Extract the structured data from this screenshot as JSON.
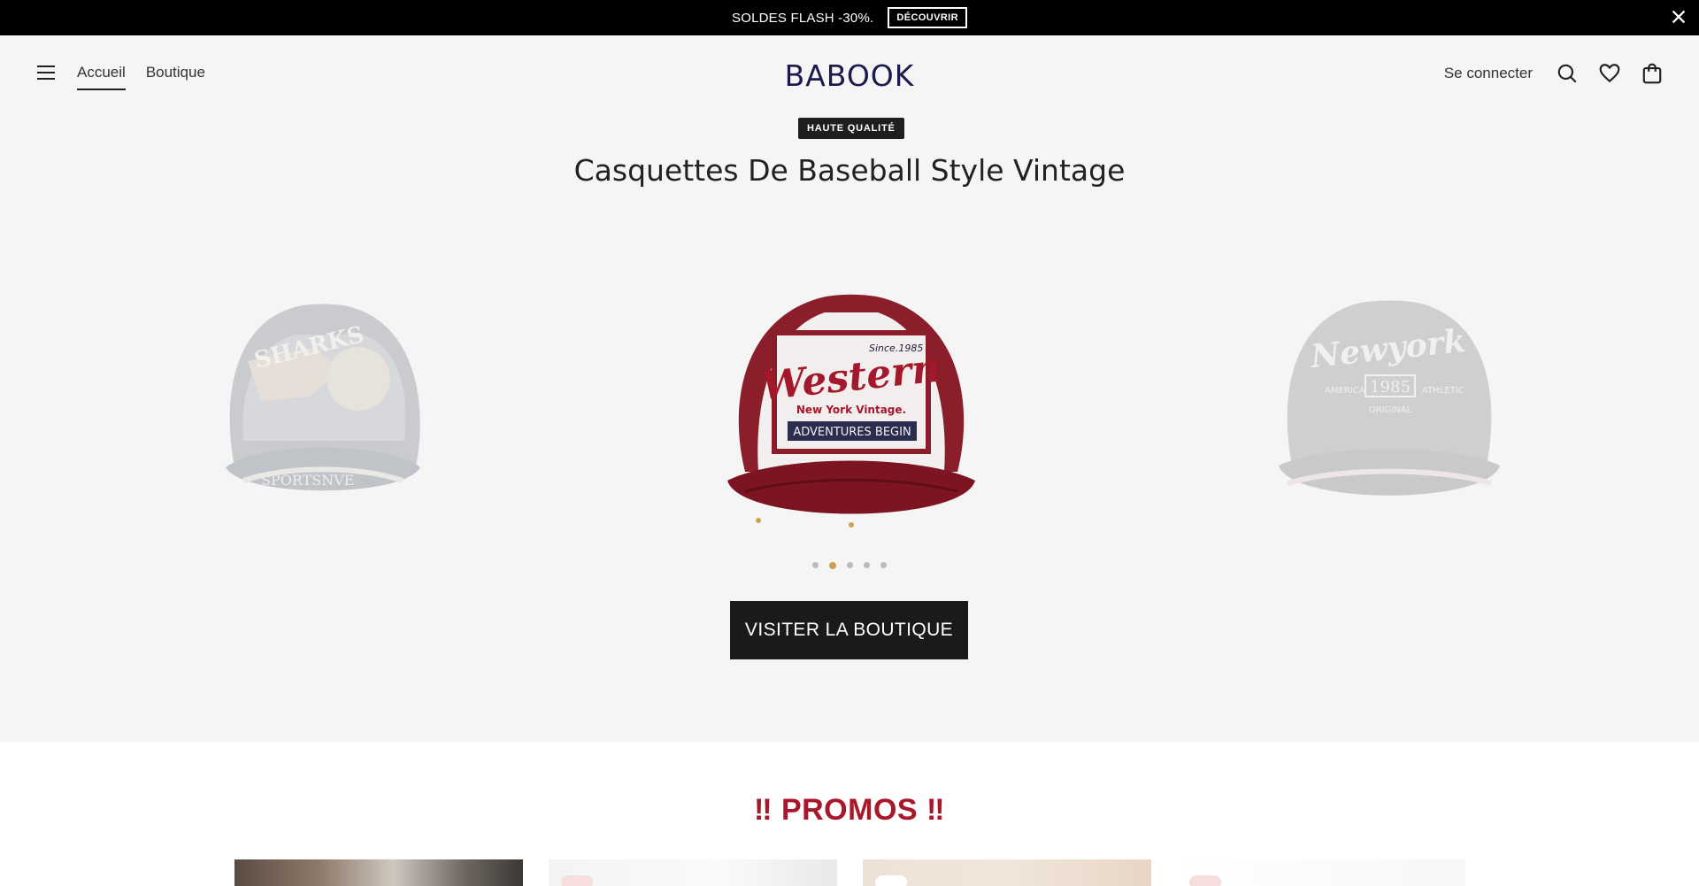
{
  "announcement": {
    "text": "SOLDES FLASH -30%.",
    "button": "DÉCOUVRIR"
  },
  "header": {
    "nav": [
      {
        "label": "Accueil",
        "active": true
      },
      {
        "label": "Boutique",
        "active": false
      }
    ],
    "logo": "BABOOK",
    "login": "Se connecter"
  },
  "hero": {
    "badge": "HAUTE QUALITÉ",
    "title": "Casquettes De Baseball Style Vintage",
    "slides": [
      {
        "name": "SHARKS cap",
        "text": [
          "SHARKS",
          "SPORTSNVE"
        ]
      },
      {
        "name": "Western cap",
        "text": [
          "Since.1985",
          "Western",
          "New York Vintage.",
          "ADVENTURES BEGIN"
        ]
      },
      {
        "name": "Newyork cap",
        "text": [
          "Newyork",
          "1985",
          "AMERICA",
          "ATHLETIC",
          "ORIGINAL"
        ]
      }
    ],
    "active_slide": 2,
    "slide_count": 5,
    "cta": "VISITER LA BOUTIQUE"
  },
  "promos": {
    "title": "PROMOS",
    "mark": "‼"
  },
  "colors": {
    "accent": "#c8a24a",
    "promo": "#a8172a",
    "logo": "#1c1a4d"
  }
}
